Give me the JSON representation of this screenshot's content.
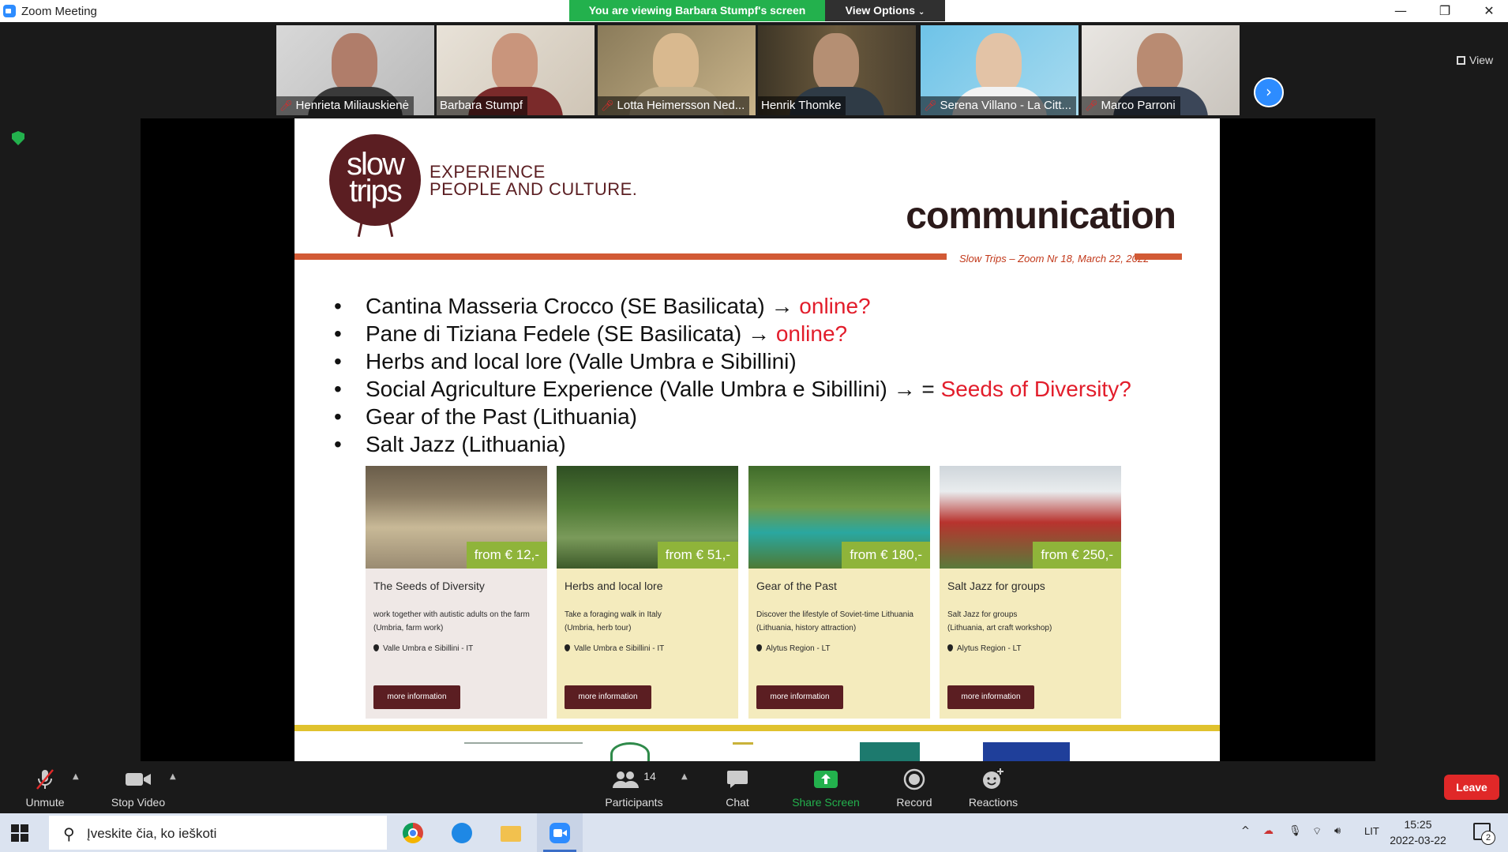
{
  "window": {
    "title": "Zoom Meeting",
    "minimize": "—",
    "maximize": "❐",
    "close": "✕"
  },
  "banner": {
    "viewing": "You are viewing Barbara Stumpf's screen",
    "view_options": "View Options"
  },
  "gallery": {
    "view_label": "View",
    "participants": [
      {
        "name": "Henrieta Miliauskienė",
        "muted": true
      },
      {
        "name": "Barbara Stumpf",
        "muted": false,
        "active": true
      },
      {
        "name": "Lotta Heimersson Ned...",
        "muted": true
      },
      {
        "name": "Henrik Thomke",
        "muted": false
      },
      {
        "name": "Serena Villano - La Citt...",
        "muted": true
      },
      {
        "name": "Marco Parroni",
        "muted": true
      }
    ]
  },
  "slide": {
    "logo_line1": "slow",
    "logo_line2": "trips",
    "tagline_1": "EXPERIENCE",
    "tagline_2": "PEOPLE AND CULTURE.",
    "title": "communication",
    "subtitle": "Slow Trips – Zoom Nr 18, March 22, 2022",
    "bullets": [
      {
        "text": "Cantina Masseria Crocco (SE Basilicata) → ",
        "highlight": "online?"
      },
      {
        "text": "Pane di Tiziana Fedele (SE Basilicata) → ",
        "highlight": "online?"
      },
      {
        "text": "Herbs and local lore (Valle Umbra e Sibillini)",
        "highlight": ""
      },
      {
        "text": "Social Agriculture Experience (Valle Umbra e Sibillini) → = ",
        "highlight": "Seeds of Diversity?"
      },
      {
        "text": "Gear of the Past (Lithuania)",
        "highlight": ""
      },
      {
        "text": "Salt Jazz (Lithuania)",
        "highlight": ""
      }
    ],
    "cards": [
      {
        "price": "from € 12,-",
        "title": "The Seeds of Diversity",
        "desc1": "work together with autistic adults on the farm",
        "desc2": "(Umbria, farm work)",
        "location": "Valle Umbra e Sibillini - IT",
        "button": "more information"
      },
      {
        "price": "from € 51,-",
        "title": "Herbs and local lore",
        "desc1": "Take a foraging walk in Italy",
        "desc2": "(Umbria, herb tour)",
        "location": "Valle Umbra e Sibillini - IT",
        "button": "more information"
      },
      {
        "price": "from € 180,-",
        "title": "Gear of the Past",
        "desc1": "Discover the lifestyle of Soviet-time Lithuania",
        "desc2": "(Lithuania, history attraction)",
        "location": "Alytus Region - LT",
        "button": "more information"
      },
      {
        "price": "from € 250,-",
        "title": "Salt Jazz for groups",
        "desc1": "Salt Jazz for groups",
        "desc2": "(Lithuania, art craft workshop)",
        "location": "Alytus Region - LT",
        "button": "more information"
      }
    ]
  },
  "toolbar": {
    "unmute": "Unmute",
    "stop_video": "Stop Video",
    "participants": "Participants",
    "participants_count": "14",
    "chat": "Chat",
    "share_screen": "Share Screen",
    "record": "Record",
    "reactions": "Reactions",
    "leave": "Leave"
  },
  "taskbar": {
    "search_placeholder": "Įveskite čia, ko ieškoti",
    "language": "LIT",
    "time": "15:25",
    "date": "2022-03-22",
    "notifications": "2"
  },
  "colors": {
    "zoom_blue": "#2d8cff",
    "banner_green": "#23b14d",
    "leave_red": "#e02828",
    "slow_trips_brown": "#5b1e22",
    "accent_orange": "#d25a35"
  }
}
